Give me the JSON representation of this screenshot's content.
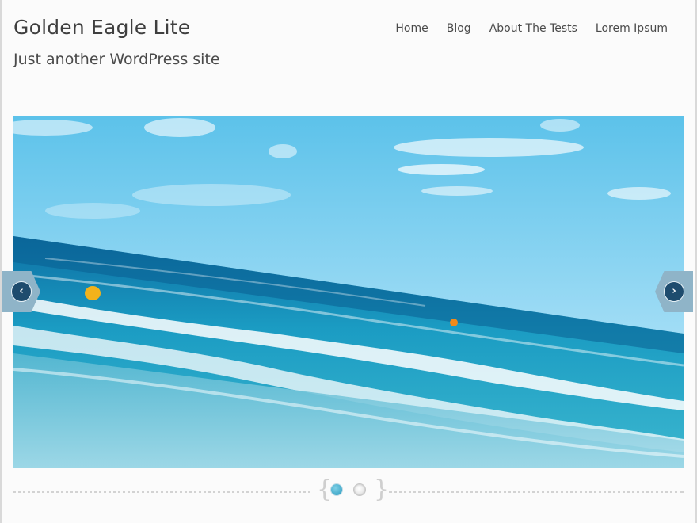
{
  "site": {
    "title": "Golden Eagle Lite",
    "description": "Just another WordPress site"
  },
  "nav": {
    "items": [
      "Home",
      "Blog",
      "About The Tests",
      "Lorem Ipsum"
    ]
  },
  "slider": {
    "image_description": "",
    "prev_icon": "chevron-left-icon",
    "next_icon": "chevron-right-icon",
    "prev_glyph": "‹",
    "next_glyph": "›",
    "slide_count": 2,
    "active_slide": 1
  },
  "colors": {
    "page_background": "#fbfbfb",
    "arrow_hex": "#8fb4c8",
    "arrow_circle": "#1e4c6e",
    "active_dot": "#2a9abf"
  }
}
